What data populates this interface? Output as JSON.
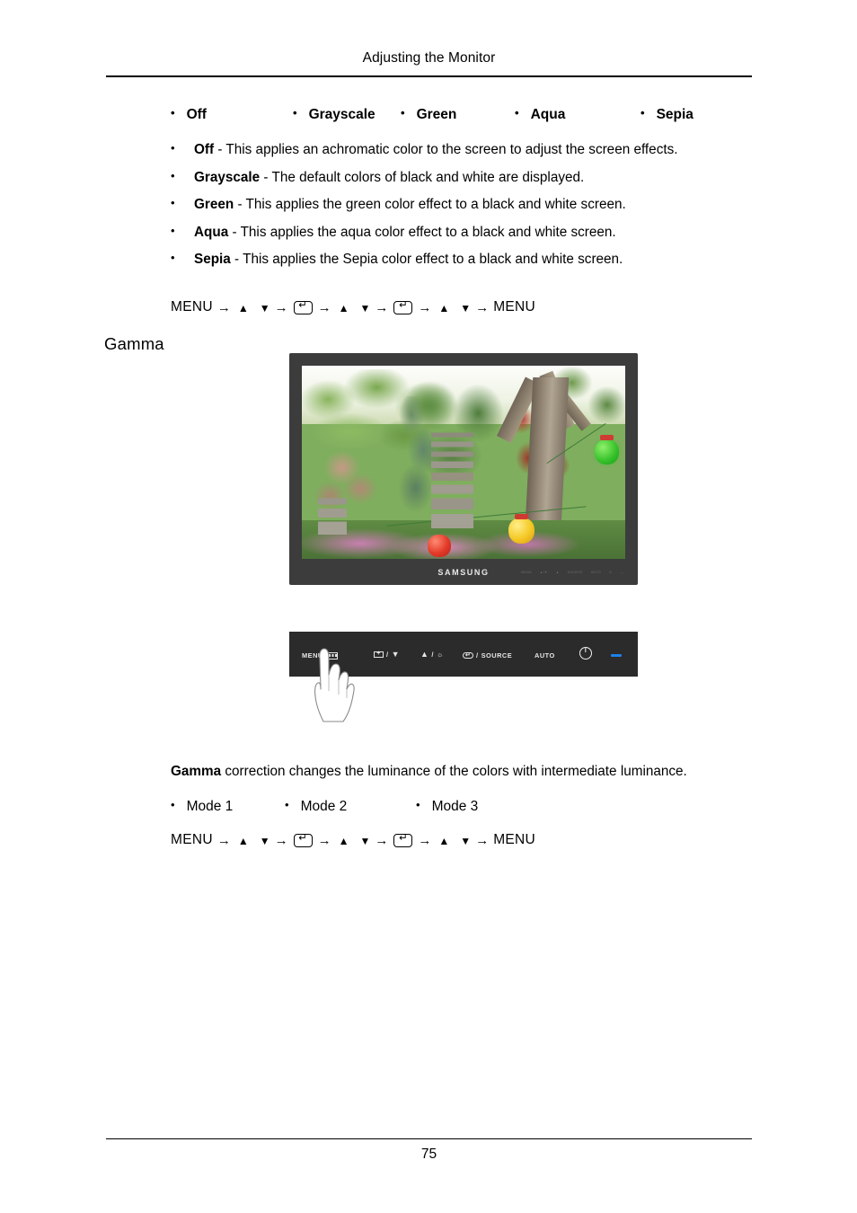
{
  "document": {
    "header_title": "Adjusting the Monitor",
    "page_number": "75"
  },
  "color_effect_options": {
    "bullet": "•",
    "items": [
      {
        "label": "Off"
      },
      {
        "label": "Grayscale"
      },
      {
        "label": "Green"
      },
      {
        "label": "Aqua"
      },
      {
        "label": "Sepia"
      }
    ]
  },
  "color_effect_descriptions": [
    {
      "term": "Off",
      "text": " - This applies an achromatic color to the screen to adjust the screen effects."
    },
    {
      "term": "Grayscale",
      "text": " - The default colors of black and white are displayed."
    },
    {
      "term": "Green",
      "text": " - This applies the green color effect to a black and white screen."
    },
    {
      "term": "Aqua",
      "text": " - This applies the aqua color effect to a black and white screen."
    },
    {
      "term": "Sepia",
      "text": " - This applies the Sepia color effect to a black and white screen."
    }
  ],
  "menu_navigation": {
    "start_label": "MENU",
    "end_label": "MENU",
    "arrow": "→",
    "up_glyph": "▲",
    "down_glyph": "▼",
    "enter_glyph": "↵",
    "enter_icon_name": "enter-key-icon"
  },
  "gamma_section": {
    "heading": "Gamma",
    "description_term": "Gamma",
    "description_text": " correction changes the luminance of the colors with intermediate luminance.",
    "modes_bullet": "•",
    "modes": [
      {
        "label": "Mode 1"
      },
      {
        "label": "Mode 2"
      },
      {
        "label": "Mode 3"
      }
    ]
  },
  "monitor_figure": {
    "brand_logo": "SAMSUNG",
    "bezel_labels": [
      "MENU",
      "▲/▼",
      "▲",
      "SOURCE",
      "AUTO",
      "⏻",
      "—"
    ],
    "screen_content": "Garden photograph with stone pagodas, green trees, red foliage and colored paper lanterns",
    "bezel_color": "#3c3c3c",
    "screen_colors": {
      "sky": "#fdfdfb",
      "foliage_green": "#6f9e48",
      "foliage_red": "#a8402f",
      "trunk": "#a2957f",
      "lantern_green": "#36c12a",
      "lantern_yellow": "#f5c825",
      "lantern_red": "#e23a28",
      "flowers": "#d488b8"
    }
  },
  "control_panel": {
    "background_color": "#2b2b2b",
    "led_color": "#1f7fe8",
    "buttons": [
      {
        "name": "menu-button",
        "label": "MENU",
        "icon": "menu-grid-icon"
      },
      {
        "name": "down-button",
        "label": "",
        "icon": "plus-box-icon",
        "separator": "/",
        "glyph": "▼"
      },
      {
        "name": "up-button",
        "label": "",
        "glyph": "▲",
        "separator": "/",
        "icon": "brightness-sun-icon",
        "sun_glyph": "☼"
      },
      {
        "name": "source-button",
        "label": "SOURCE",
        "icon": "enter-box-icon",
        "separator": "/"
      },
      {
        "name": "auto-button",
        "label": "AUTO"
      },
      {
        "name": "power-button",
        "label": "",
        "icon": "power-icon"
      },
      {
        "name": "power-led",
        "label": "",
        "icon": "led-indicator"
      }
    ],
    "hand_cursor": "pointing-hand-illustration"
  }
}
